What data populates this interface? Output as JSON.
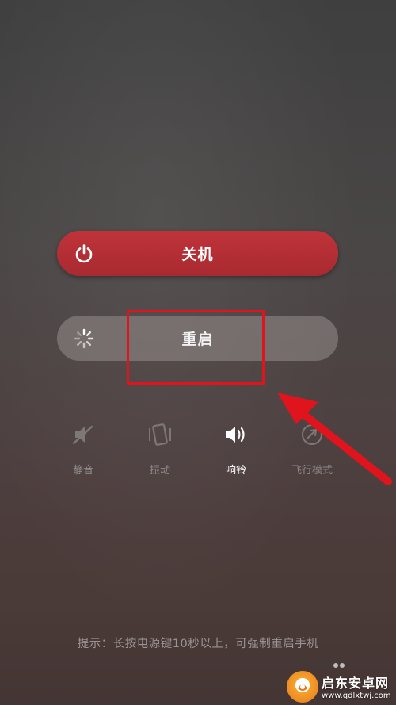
{
  "power_menu": {
    "shutdown_label": "关机",
    "restart_label": "重启"
  },
  "sound_modes": [
    {
      "label": "静音",
      "icon": "mute-icon",
      "active": false
    },
    {
      "label": "振动",
      "icon": "vibrate-icon",
      "active": false
    },
    {
      "label": "响铃",
      "icon": "ring-icon",
      "active": true
    },
    {
      "label": "飞行模式",
      "icon": "airplane-icon",
      "active": false
    }
  ],
  "hint": "提示：长按电源键10秒以上，可强制重启手机",
  "watermark": {
    "title": "启东安卓网",
    "url": "www.qdlxtwj.com"
  },
  "colors": {
    "shutdown_red": "#b8303a",
    "annotation_red": "#e0141c",
    "inactive_text": "#8e8a8a"
  }
}
